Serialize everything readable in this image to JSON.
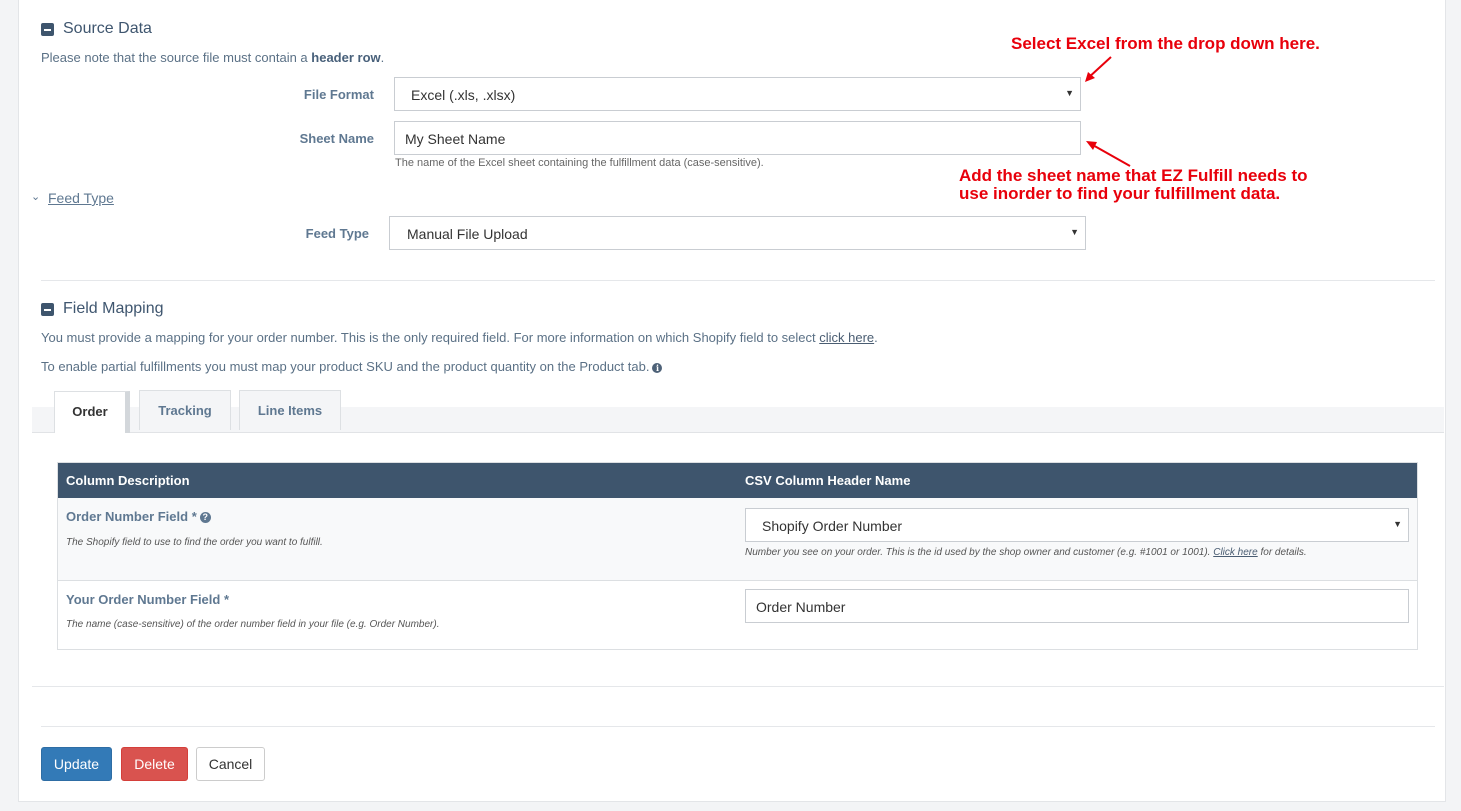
{
  "source": {
    "title": "Source Data",
    "note_prefix": "Please note that the source file must contain a ",
    "note_bold": "header row",
    "note_suffix": ".",
    "file_format_label": "File Format",
    "file_format_value": "Excel (.xls, .xlsx)",
    "sheet_name_label": "Sheet Name",
    "sheet_name_value": "My Sheet Name",
    "sheet_name_help": "The name of the Excel sheet containing the fulfillment data (case-sensitive)."
  },
  "annotations": {
    "select_excel": "Select Excel from the drop down here.",
    "sheet_name_line1": "Add the sheet name that EZ Fulfill needs to",
    "sheet_name_line2": "use inorder to find your fulfillment data.",
    "color": "#e8000b"
  },
  "feed": {
    "section_link": "Feed Type",
    "label": "Feed Type",
    "value": "Manual File Upload"
  },
  "mapping": {
    "title": "Field Mapping",
    "note1_prefix": "You must provide a mapping for your order number. This is the only required field. For more information on which Shopify field to select ",
    "note1_link": "click here",
    "note1_suffix": ".",
    "note2": "To enable partial fulfillments you must map your product SKU and the product quantity on the Product tab.",
    "tabs": [
      "Order",
      "Tracking",
      "Line Items"
    ],
    "table": {
      "col1": "Column Description",
      "col2": "CSV Column Header Name",
      "rows": [
        {
          "name": "Order Number Field *",
          "desc": "The Shopify field to use to find the order you want to fulfill.",
          "value": "Shopify Order Number",
          "help_prefix": "Number you see on your order. This is the id used by the shop owner and customer (e.g. #1001 or 1001). ",
          "help_link": "Click here",
          "help_suffix": " for details."
        },
        {
          "name": "Your Order Number Field *",
          "desc": "The name (case-sensitive) of the order number field in your file (e.g. Order Number).",
          "value": "Order Number"
        }
      ]
    }
  },
  "actions": {
    "update": "Update",
    "delete": "Delete",
    "cancel": "Cancel"
  },
  "colors": {
    "header_bg": "#3e556d",
    "update": "#337ab7",
    "delete": "#d9534f"
  }
}
